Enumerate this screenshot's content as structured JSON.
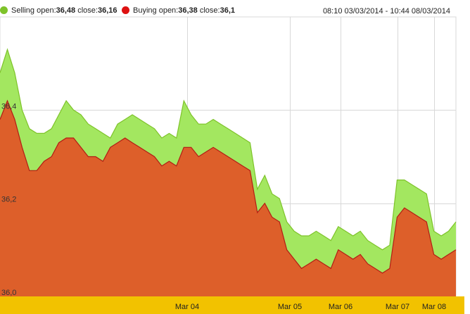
{
  "legend": {
    "selling": {
      "prefix": "Selling",
      "open_label": "open:",
      "open": "36,48",
      "close_label": "close:",
      "close": "36,16",
      "color": "#7ec32a"
    },
    "buying": {
      "prefix": "Buying",
      "open_label": "open:",
      "open": "36,38",
      "close_label": "close:",
      "close": "36,1",
      "color": "#dd1111"
    }
  },
  "date_range": "08:10 03/03/2014 - 10:44 08/03/2014",
  "chart_data": {
    "type": "area",
    "x_tick_labels": [
      "Mar 04",
      "Mar 05",
      "Mar 06",
      "Mar 07",
      "Mar 08"
    ],
    "y_tick_labels": [
      "36,0",
      "36,2",
      "36,4"
    ],
    "y_ticks": [
      36.0,
      36.2,
      36.4
    ],
    "ylim": [
      36.0,
      36.6
    ],
    "grid": true,
    "axis_bar_color": "#f2c200",
    "series": [
      {
        "name": "Selling",
        "color": "#a3e760",
        "edge_color": "#7ec32a",
        "values": [
          36.48,
          36.53,
          36.48,
          36.4,
          36.36,
          36.35,
          36.35,
          36.36,
          36.39,
          36.42,
          36.4,
          36.39,
          36.37,
          36.36,
          36.35,
          36.34,
          36.37,
          36.38,
          36.39,
          36.38,
          36.37,
          36.36,
          36.34,
          36.35,
          36.34,
          36.42,
          36.39,
          36.37,
          36.37,
          36.38,
          36.37,
          36.36,
          36.35,
          36.34,
          36.33,
          36.23,
          36.26,
          36.22,
          36.21,
          36.16,
          36.14,
          36.13,
          36.13,
          36.14,
          36.13,
          36.12,
          36.15,
          36.14,
          36.13,
          36.14,
          36.12,
          36.11,
          36.1,
          36.11,
          36.25,
          36.25,
          36.24,
          36.23,
          36.22,
          36.14,
          36.13,
          36.14,
          36.16
        ]
      },
      {
        "name": "Buying",
        "color": "#dd5f2a",
        "edge_color": "#b31d15",
        "values": [
          36.38,
          36.42,
          36.38,
          36.32,
          36.27,
          36.27,
          36.29,
          36.3,
          36.33,
          36.34,
          36.34,
          36.32,
          36.3,
          36.3,
          36.29,
          36.32,
          36.33,
          36.34,
          36.33,
          36.32,
          36.31,
          36.3,
          36.28,
          36.29,
          36.28,
          36.32,
          36.32,
          36.3,
          36.31,
          36.32,
          36.31,
          36.3,
          36.29,
          36.28,
          36.27,
          36.18,
          36.2,
          36.17,
          36.16,
          36.1,
          36.08,
          36.06,
          36.07,
          36.08,
          36.07,
          36.06,
          36.1,
          36.09,
          36.08,
          36.09,
          36.07,
          36.06,
          36.05,
          36.06,
          36.17,
          36.19,
          36.18,
          36.17,
          36.16,
          36.09,
          36.08,
          36.09,
          36.1
        ]
      }
    ]
  }
}
